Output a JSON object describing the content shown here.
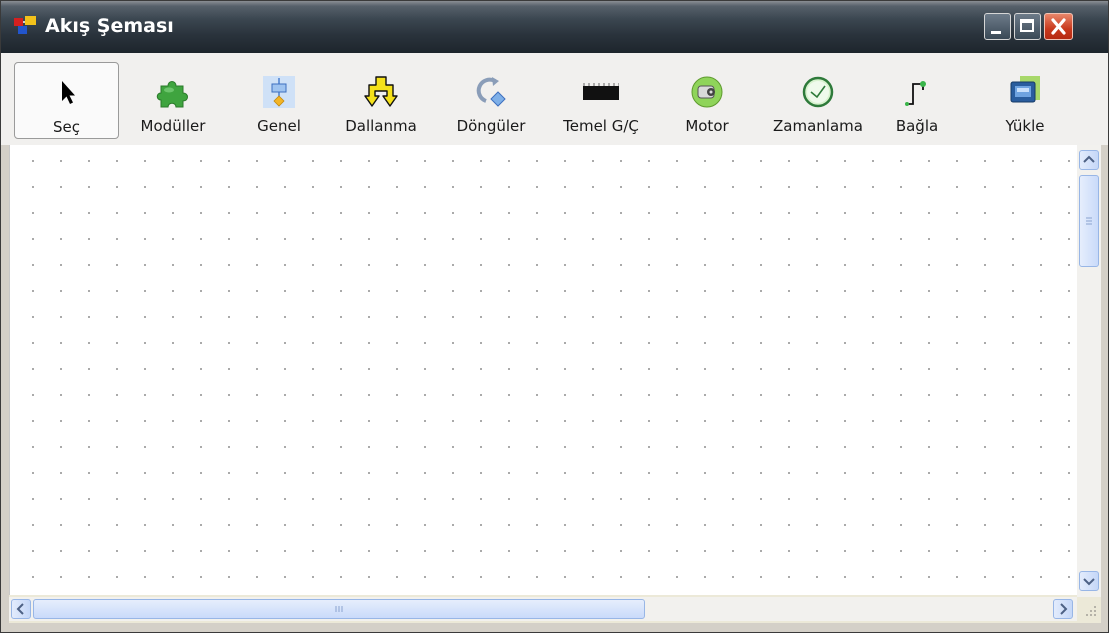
{
  "window": {
    "title": "Akış Şeması",
    "app_icon": "flowchart-app-icon",
    "controls": [
      "minimize-icon",
      "maximize-icon",
      "close-icon"
    ]
  },
  "toolbar": {
    "selected": "Seç",
    "tools": [
      {
        "label": "Seç",
        "icon": "cursor-arrow-icon"
      },
      {
        "label": "Modüller",
        "icon": "puzzle-piece-icon"
      },
      {
        "label": "Genel",
        "icon": "process-block-icon"
      },
      {
        "label": "Dallanma",
        "icon": "branch-icon"
      },
      {
        "label": "Döngüler",
        "icon": "loop-icon"
      },
      {
        "label": "Temel G/Ç",
        "icon": "chip-io-icon"
      },
      {
        "label": "Motor",
        "icon": "motor-icon"
      },
      {
        "label": "Zamanlama",
        "icon": "clock-icon"
      },
      {
        "label": "Bağla",
        "icon": "connect-wire-icon"
      },
      {
        "label": "Yükle",
        "icon": "download-device-icon"
      }
    ]
  },
  "scrollbars": {
    "vertical": {
      "thumb_position": 0.0
    },
    "horizontal": {
      "thumb_position": 0.0
    }
  },
  "colors": {
    "titlebar": "#2a333c",
    "toolbar_bg": "#f1f0ee",
    "canvas_bg": "#ffffff",
    "grid_dot": "#9a9a9a",
    "close_button": "#c9391d",
    "scrollbar_accent": "#c5d7f8"
  }
}
